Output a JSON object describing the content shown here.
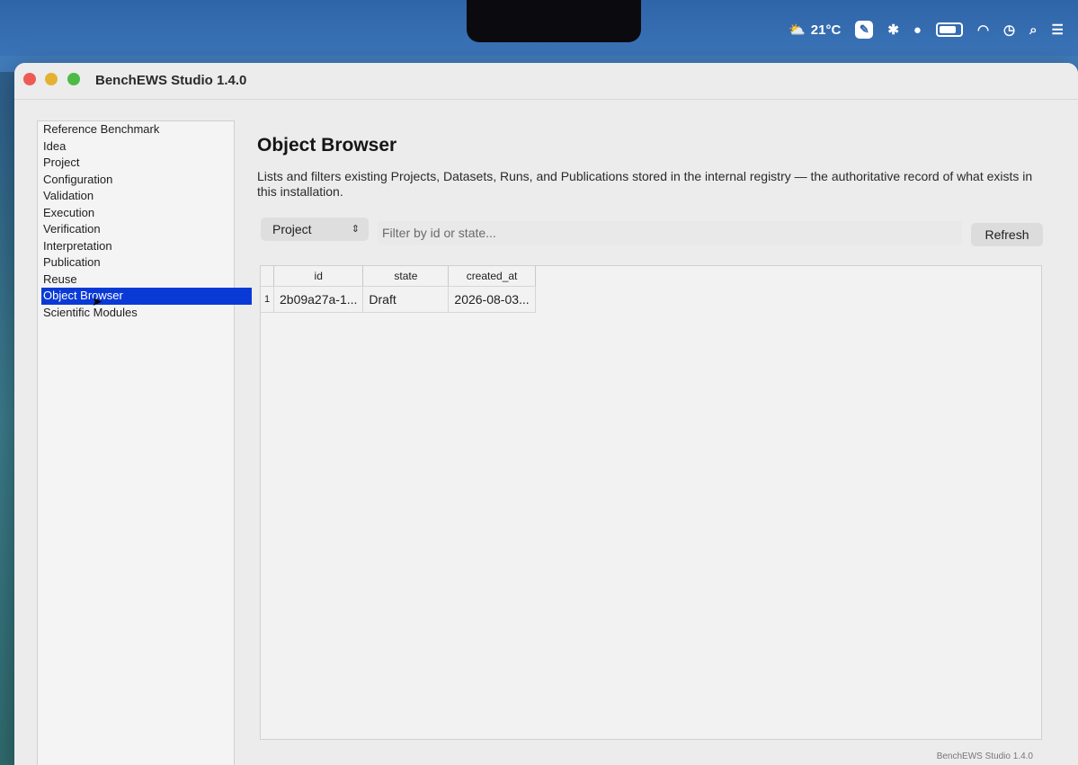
{
  "menubar": {
    "weather_temp": "21°C"
  },
  "window": {
    "title": "BenchEWS Studio 1.4.0",
    "footer": "BenchEWS Studio 1.4.0"
  },
  "sidebar": {
    "items": [
      {
        "label": "Reference Benchmark"
      },
      {
        "label": "Idea"
      },
      {
        "label": "Project"
      },
      {
        "label": "Configuration"
      },
      {
        "label": "Validation"
      },
      {
        "label": "Execution"
      },
      {
        "label": "Verification"
      },
      {
        "label": "Interpretation"
      },
      {
        "label": "Publication"
      },
      {
        "label": "Reuse"
      },
      {
        "label": "Object Browser",
        "selected": true
      },
      {
        "label": "Scientific Modules"
      }
    ]
  },
  "main": {
    "title": "Object Browser",
    "description": "Lists and filters existing Projects, Datasets, Runs, and Publications stored in the internal registry — the authoritative record of what exists in this installation.",
    "type_select": {
      "value": "Project"
    },
    "filter": {
      "placeholder": "Filter by id or state..."
    },
    "refresh_label": "Refresh",
    "table": {
      "columns": [
        "id",
        "state",
        "created_at"
      ],
      "rows": [
        {
          "num": "1",
          "id": "2b09a27a-1...",
          "state": "Draft",
          "created_at": "2026-08-03..."
        }
      ]
    }
  }
}
